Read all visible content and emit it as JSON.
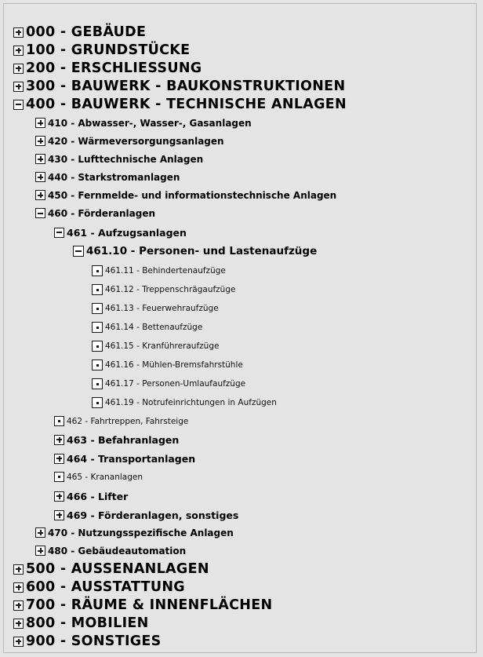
{
  "tree": {
    "items": [
      {
        "label": "000 - GEBÄUDE",
        "state": "collapsed"
      },
      {
        "label": "100 - GRUNDSTÜCKE",
        "state": "collapsed"
      },
      {
        "label": "200 - ERSCHLIESSUNG",
        "state": "collapsed"
      },
      {
        "label": "300 - BAUWERK - BAUKONSTRUKTIONEN",
        "state": "collapsed"
      },
      {
        "label": "400 - BAUWERK - TECHNISCHE ANLAGEN",
        "state": "expanded"
      },
      {
        "label": "410 - Abwasser-, Wasser-, Gasanlagen",
        "state": "collapsed"
      },
      {
        "label": "420 - Wärmeversorgungsanlagen",
        "state": "collapsed"
      },
      {
        "label": "430 - Lufttechnische Anlagen",
        "state": "collapsed"
      },
      {
        "label": "440 - Starkstromanlagen",
        "state": "collapsed"
      },
      {
        "label": "450 - Fernmelde- und informationstechnische Anlagen",
        "state": "collapsed"
      },
      {
        "label": "460 - Förderanlagen",
        "state": "expanded"
      },
      {
        "label": "461 - Aufzugsanlagen",
        "state": "expanded"
      },
      {
        "label": "461.10 - Personen- und Lastenaufzüge",
        "state": "expanded"
      },
      {
        "label": "461.11 - Behindertenaufzüge",
        "state": "leaf"
      },
      {
        "label": "461.12 - Treppenschrägaufzüge",
        "state": "leaf"
      },
      {
        "label": "461.13 - Feuerwehraufzüge",
        "state": "leaf"
      },
      {
        "label": "461.14 - Bettenaufzüge",
        "state": "leaf"
      },
      {
        "label": "461.15 - Kranführeraufzüge",
        "state": "leaf"
      },
      {
        "label": "461.16 - Mühlen-Bremsfahrstühle",
        "state": "leaf"
      },
      {
        "label": "461.17 - Personen-Umlaufaufzüge",
        "state": "leaf"
      },
      {
        "label": "461.19 - Notrufeinrichtungen in Aufzügen",
        "state": "leaf"
      },
      {
        "label": "462 - Fahrtreppen, Fahrsteige",
        "state": "leaf"
      },
      {
        "label": "463 - Befahranlagen",
        "state": "collapsed"
      },
      {
        "label": "464 - Transportanlagen",
        "state": "collapsed"
      },
      {
        "label": "465 - Krananlagen",
        "state": "leaf"
      },
      {
        "label": "466 - Lifter",
        "state": "collapsed"
      },
      {
        "label": "469 - Förderanlagen, sonstiges",
        "state": "collapsed"
      },
      {
        "label": "470 - Nutzungsspezifische Anlagen",
        "state": "collapsed"
      },
      {
        "label": "480 - Gebäudeautomation",
        "state": "collapsed"
      },
      {
        "label": "500 - AUSSENANLAGEN",
        "state": "collapsed"
      },
      {
        "label": "600 - AUSSTATTUNG",
        "state": "collapsed"
      },
      {
        "label": "700 - RÄUME & INNENFLÄCHEN",
        "state": "collapsed"
      },
      {
        "label": "800 - MOBILIEN",
        "state": "collapsed"
      },
      {
        "label": "900 - SONSTIGES",
        "state": "collapsed"
      }
    ]
  }
}
